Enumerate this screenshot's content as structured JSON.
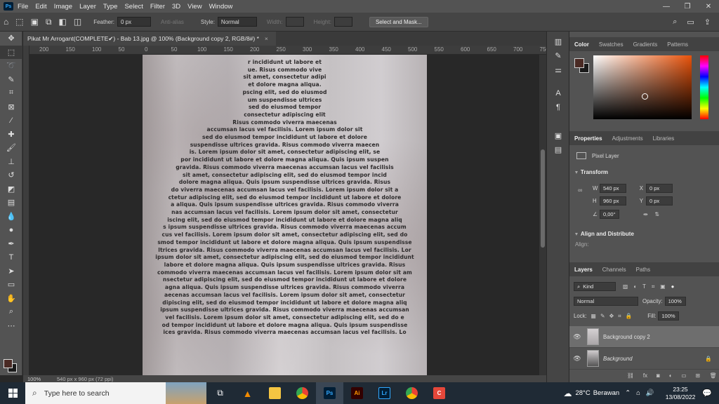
{
  "menu": {
    "app_icon": "Ps",
    "items": [
      "File",
      "Edit",
      "Image",
      "Layer",
      "Type",
      "Select",
      "Filter",
      "3D",
      "View",
      "Window"
    ],
    "window_controls": [
      "—",
      "❐",
      "✕"
    ]
  },
  "options": {
    "feather_label": "Feather:",
    "feather_value": "0 px",
    "antialias_label": "Anti-alias",
    "style_label": "Style:",
    "style_value": "Normal",
    "width_label": "Width:",
    "height_label": "Height:",
    "select_mask_label": "Select and Mask..."
  },
  "document": {
    "tab_title": "Pikat Mr Arrogant(COMPLETE✔) - Bab 13.jpg @ 100% (Background copy 2, RGB/8#) *",
    "tab_close": "×",
    "ruler_ticks": [
      "200",
      "150",
      "100",
      "50",
      "0",
      "50",
      "100",
      "150",
      "200",
      "250",
      "300",
      "350",
      "400",
      "450",
      "500",
      "550",
      "600",
      "650",
      "700",
      "750"
    ],
    "text_lines": [
      "r incididunt ut labore et",
      "ue. Risus commodo vive",
      "sit amet, consectetur adipi",
      "et dolore magna aliqua.",
      "pscing elit, sed do eiusmod",
      "um suspendisse ultrices",
      "sed do eiusmod tempor",
      "consectetur adipiscing elit",
      "Risus commodo viverra maecenas",
      "accumsan lacus vel facilisis. Lorem ipsum dolor sit",
      "sed do eiusmod tempor incididunt ut labore et dolore",
      "suspendisse ultrices gravida. Risus commodo viverra maecen",
      "is. Lorem ipsum dolor sit amet, consectetur adipiscing elit, se",
      "por incididunt ut labore et dolore magna aliqua. Quis ipsum suspen",
      "gravida. Risus commodo viverra maecenas accumsan lacus vel facilisis",
      "sit amet, consectetur adipiscing elit, sed do eiusmod tempor incid",
      "dolore magna aliqua. Quis ipsum suspendisse ultrices gravida. Risus",
      "do viverra maecenas accumsan lacus vel facilisis. Lorem ipsum dolor sit a",
      "ctetur adipiscing elit, sed do eiusmod tempor incididunt ut labore et dolore",
      "a aliqua. Quis ipsum suspendisse ultrices gravida. Risus commodo viverra",
      "nas accumsan lacus vel facilisis. Lorem ipsum dolor sit amet, consectetur",
      "iscing elit, sed do eiusmod tempor incididunt ut labore et dolore magna aliq",
      "s ipsum suspendisse ultrices gravida. Risus commodo viverra maecenas accum",
      "cus vel facilisis. Lorem ipsum dolor sit amet, consectetur adipiscing elit, sed do",
      "smod tempor incididunt ut labore et dolore magna aliqua. Quis ipsum suspendisse",
      "ltrices gravida. Risus commodo viverra maecenas accumsan lacus vel facilisis. Lor",
      "ipsum dolor sit amet, consectetur adipiscing elit, sed do eiusmod tempor incididunt",
      "labore et dolore magna aliqua. Quis ipsum suspendisse ultrices gravida. Risus",
      "commodo viverra maecenas accumsan lacus vel facilisis. Lorem ipsum dolor sit am",
      "nsectetur adipiscing elit, sed do eiusmod tempor incididunt ut labore et dolore",
      "agna aliqua. Quis ipsum suspendisse ultrices gravida. Risus commodo viverra",
      "aecenas accumsan lacus vel facilisis. Lorem ipsum dolor sit amet, consectetur",
      "dipiscing elit, sed do eiusmod tempor incididunt ut labore et dolore magna aliq",
      "ipsum suspendisse ultrices gravida. Risus commodo viverra maecenas accumsan",
      "vel facilisis. Lorem ipsum dolor sit amet, consectetur adipiscing elit, sed do e",
      "od tempor incididunt ut labore et dolore magna aliqua. Quis ipsum suspendisse",
      "ices gravida. Risus commodo viverra maecenas accumsan lacus vel facilisis. Lo"
    ]
  },
  "status": {
    "zoom": "100%",
    "doc_info": "540 px x 960 px (72 ppi)"
  },
  "panels": {
    "color_tabs": [
      "Color",
      "Swatches",
      "Gradients",
      "Patterns"
    ],
    "properties_tabs": [
      "Properties",
      "Adjustments",
      "Libraries"
    ],
    "pixel_layer_label": "Pixel Layer",
    "transform": {
      "title": "Transform",
      "w_label": "W",
      "w_value": "540 px",
      "h_label": "H",
      "h_value": "960 px",
      "x_label": "X",
      "x_value": "0 px",
      "y_label": "Y",
      "y_value": "0 px",
      "angle_value": "0,00°"
    },
    "align": {
      "title": "Align and Distribute",
      "label": "Align:"
    },
    "layers_tabs": [
      "Layers",
      "Channels",
      "Paths"
    ],
    "layers_filter": "Kind",
    "blend_mode": "Normal",
    "opacity_label": "Opacity:",
    "opacity_value": "100%",
    "lock_label": "Lock:",
    "fill_label": "Fill:",
    "fill_value": "100%",
    "layers": [
      {
        "name": "Background copy 2",
        "selected": true
      },
      {
        "name": "Background",
        "selected": false
      }
    ]
  },
  "taskbar": {
    "search_placeholder": "Type here to search",
    "weather_temp": "28°C",
    "weather_desc": "Berawan",
    "time": "23:25",
    "date": "13/08/2022"
  }
}
